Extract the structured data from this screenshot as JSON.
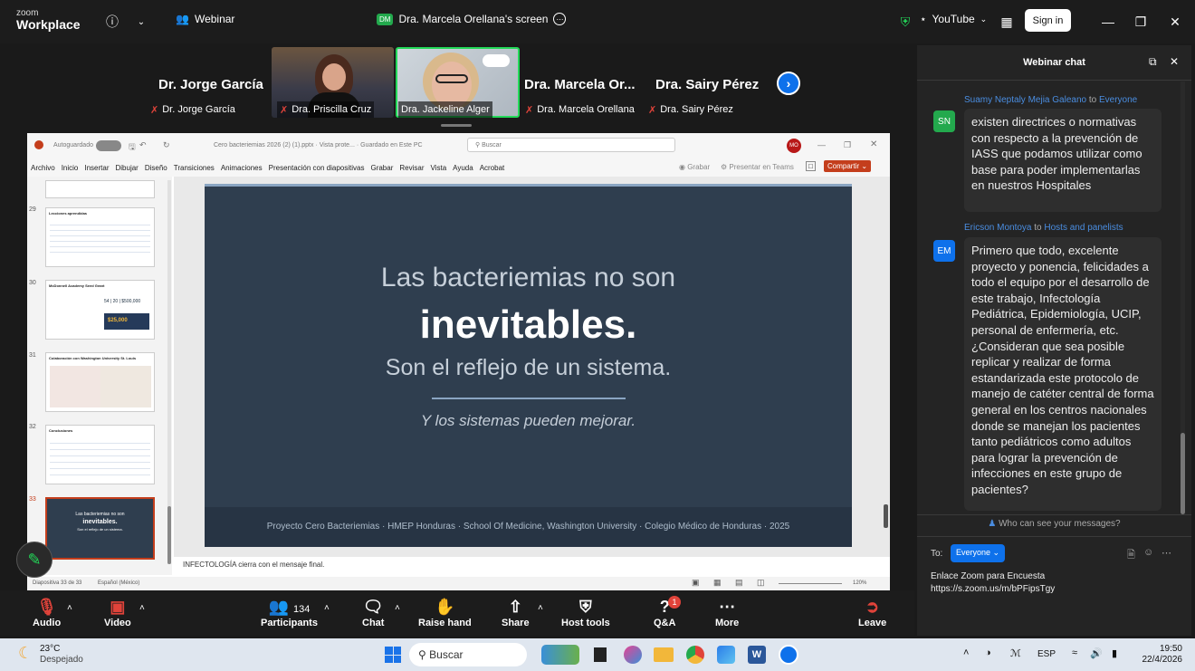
{
  "topbar": {
    "zoom_small": "zoom",
    "zoom_big": "Workplace",
    "webinar_label": "Webinar",
    "share_avatar": "DM",
    "share_title": "Dra. Marcela Orellana's screen",
    "youtube_label": "YouTube",
    "signin_label": "Sign in"
  },
  "participants": {
    "names": [
      "Dr. Jorge García",
      "Dra. Marcela Or...",
      "Dra. Sairy Pérez"
    ],
    "labels": [
      "Dr. Jorge García",
      "Dra. Priscilla Cruz",
      "Dra. Jackeline Alger",
      "Dra. Marcela Orellana",
      "Dra. Sairy Pérez"
    ]
  },
  "ppt": {
    "autosave": "Autoguardado",
    "filename": "Cero bacteriemias 2026 (2) (1).pptx · Vista prote... · Guardado en Este PC",
    "search_placeholder": "Buscar",
    "user_initials": "MO",
    "menu": [
      "Archivo",
      "Inicio",
      "Insertar",
      "Dibujar",
      "Diseño",
      "Transiciones",
      "Animaciones",
      "Presentación con diapositivas",
      "Grabar",
      "Revisar",
      "Vista",
      "Ayuda",
      "Acrobat"
    ],
    "record_label": "Grabar",
    "teams_label": "Presentar en Teams",
    "share_label": "Compartir",
    "thumb_numbers": [
      "29",
      "30",
      "31",
      "32",
      "33"
    ],
    "thumb_titles": [
      "Lecciones aprendidas",
      "McDonnell Academy Seed Grant",
      "Colaboración con Washington University St. Louis",
      "Conclusiones",
      "inevitables."
    ],
    "thumb30_stats": "54 | 20 | $500,000",
    "thumb30_money": "$25,000",
    "thumb33_line1": "Las bacteriemias no son",
    "thumb33_line3": "Son el reflejo de un sistema.",
    "slide": {
      "line1": "Las bacteriemias no son",
      "line2": "inevitables.",
      "line3": "Son el reflejo de un sistema.",
      "line4": "Y los sistemas pueden mejorar.",
      "footer": "Proyecto Cero Bacteriemias  ·  HMEP Honduras  · School Of Medicine, Washington University · Colegio Médico de Honduras  ·  2025"
    },
    "notes": "INFECTOLOGÍA cierra con el mensaje final.",
    "status_slide": "Diapositiva 33 de 33",
    "status_lang": "Español (México)",
    "zoom_pct": "120%"
  },
  "zoombar": {
    "audio": "Audio",
    "video": "Video",
    "participants": "Participants",
    "participants_count": "134",
    "chat": "Chat",
    "raise_hand": "Raise hand",
    "share": "Share",
    "host_tools": "Host tools",
    "qa": "Q&A",
    "qa_badge": "1",
    "more": "More",
    "leave": "Leave"
  },
  "chat": {
    "title": "Webinar chat",
    "msg1_sender": "Suamy Neptaly Mejia Galeano",
    "msg1_to": "to",
    "msg1_target": "Everyone",
    "msg1_initials": "SN",
    "msg1_text": "existen directrices o normativas con respecto a la prevención de IASS que podamos utilizar como base para poder implementarlas en nuestros Hospitales",
    "msg2_sender": "Ericson Montoya",
    "msg2_to": "to",
    "msg2_target": "Hosts and panelists",
    "msg2_initials": "EM",
    "msg2_text": "Primero que todo, excelente proyecto y ponencia, felicidades a todo el equipo por el desarrollo de este trabajo, Infectología Pediátrica, Epidemiología, UCIP, personal de enfermería, etc. ¿Consideran que sea posible replicar y realizar de forma estandarizada este protocolo de manejo de catéter central de forma general en los centros nacionales donde se manejan los pacientes tanto pediátricos como adultos para lograr la prevención de infecciones en este grupo de pacientes?",
    "who_can_see": "Who can see your messages?",
    "to_label": "To:",
    "to_target": "Everyone",
    "draft_line1": "Enlace Zoom para Encuesta",
    "draft_line2": "https://s.zoom.us/m/bPFipsTgy"
  },
  "taskbar": {
    "temp": "23°C",
    "weather": "Despejado",
    "search": "Buscar",
    "lang": "ESP",
    "time": "19:50",
    "date": "22/4/2026"
  },
  "colors": {
    "accent": "#0e71eb",
    "green": "#23d959",
    "red": "#e0433a",
    "ppt_red": "#c43e1c"
  }
}
